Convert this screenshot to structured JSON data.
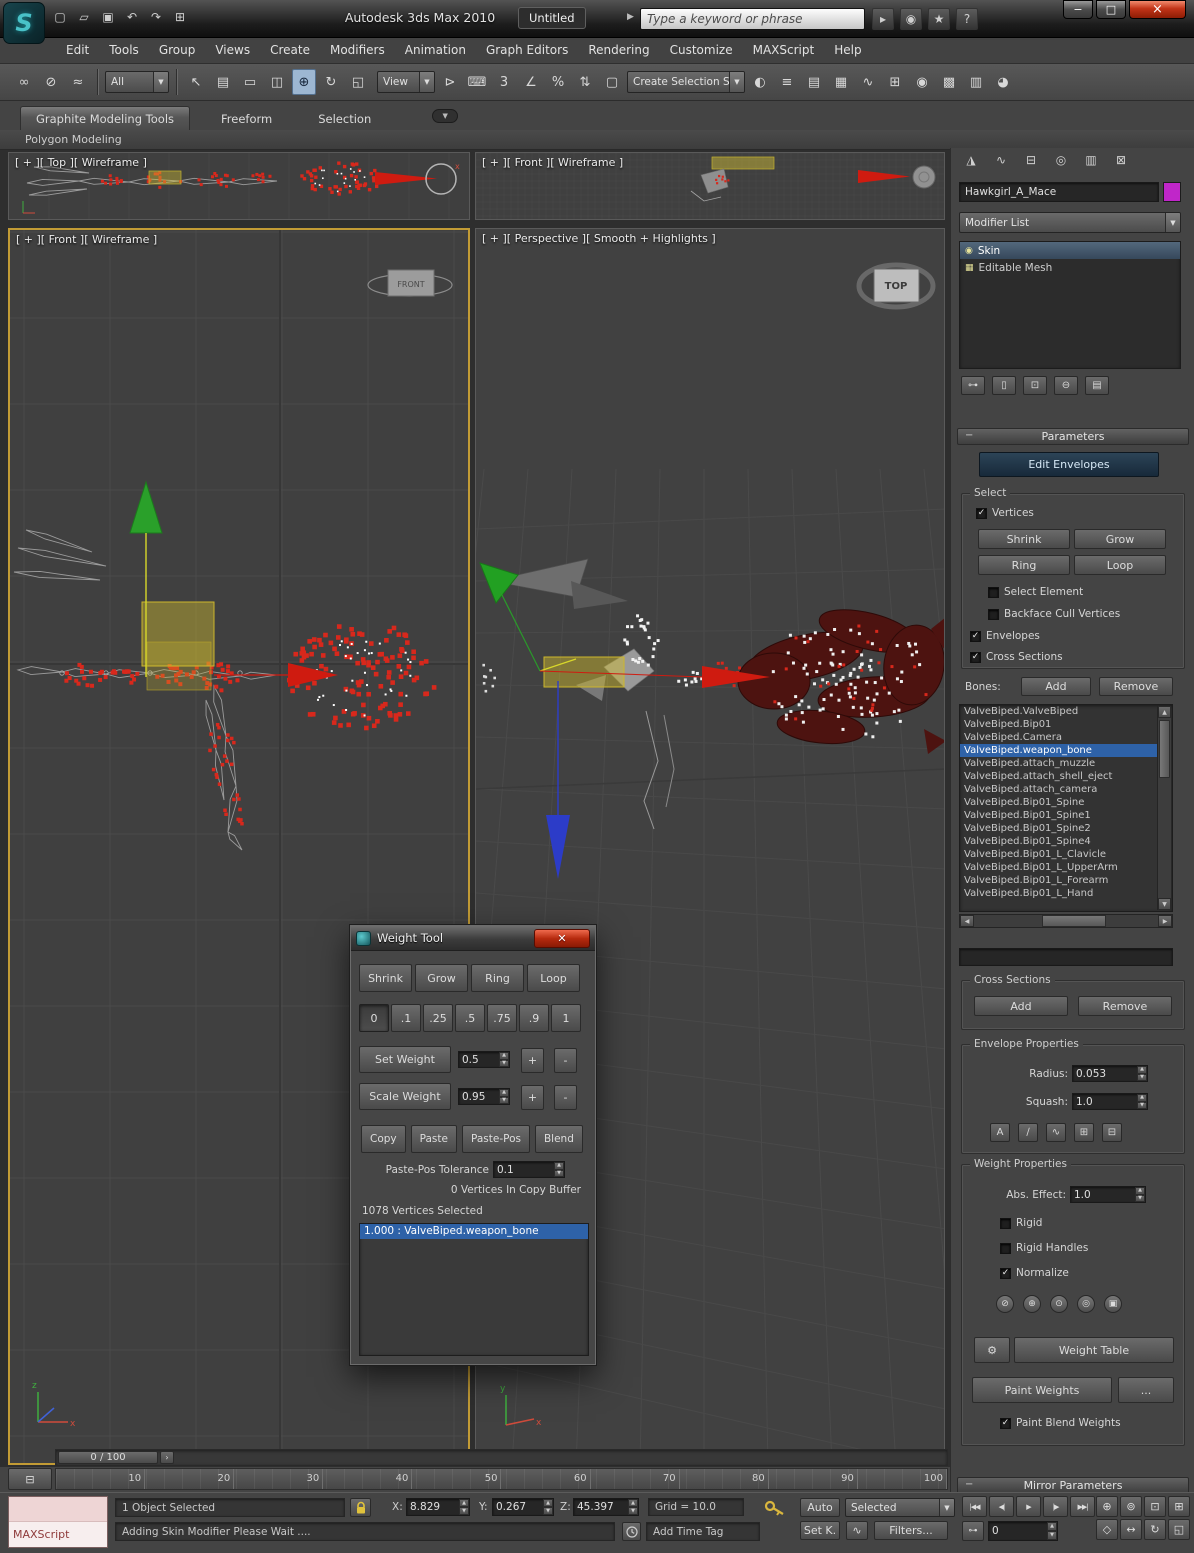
{
  "titlebar": {
    "app_title": "Autodesk 3ds Max  2010",
    "doc_title": "Untitled",
    "search_placeholder": "Type a keyword or phrase",
    "quick_icons": [
      {
        "n": "new-scene-icon",
        "g": "▢"
      },
      {
        "n": "open-file-icon",
        "g": "▱"
      },
      {
        "n": "save-file-icon",
        "g": "▣"
      },
      {
        "n": "undo-icon",
        "g": "↶"
      },
      {
        "n": "redo-icon",
        "g": "↷"
      },
      {
        "n": "clipboard-icon",
        "g": "⊞"
      }
    ],
    "infocenter_icons": [
      {
        "n": "search-go-icon",
        "g": "▸"
      },
      {
        "n": "communication-center-icon",
        "g": "◉"
      },
      {
        "n": "favorites-star-icon",
        "g": "★"
      },
      {
        "n": "help-icon",
        "g": "?"
      }
    ],
    "window_buttons": {
      "minimize": "−",
      "maximize": "□",
      "close": "×"
    }
  },
  "menu_items": [
    "Edit",
    "Tools",
    "Group",
    "Views",
    "Create",
    "Modifiers",
    "Animation",
    "Graph Editors",
    "Rendering",
    "Customize",
    "MAXScript",
    "Help"
  ],
  "toolbar": {
    "selection_filter": "All",
    "view_dropdown": "View",
    "named_selection": "Create Selection S",
    "icons_a": [
      {
        "n": "select-and-link-icon",
        "g": "∞"
      },
      {
        "n": "unlink-selection-icon",
        "g": "⊘"
      },
      {
        "n": "bind-to-spacewarp-icon",
        "g": "≈"
      }
    ],
    "icons_b": [
      {
        "n": "select-object-icon",
        "g": "↖"
      },
      {
        "n": "select-by-name-icon",
        "g": "▤"
      },
      {
        "n": "rectangular-selection-region-icon",
        "g": "▭"
      },
      {
        "n": "window-crossing-toggle-icon",
        "g": "◫"
      },
      {
        "n": "select-and-move-icon",
        "g": "⊕",
        "active": true
      },
      {
        "n": "select-and-rotate-icon",
        "g": "↻"
      },
      {
        "n": "select-and-scale-icon",
        "g": "◱"
      }
    ],
    "icons_c": [
      {
        "n": "select-and-manipulate-icon",
        "g": "⊳"
      },
      {
        "n": "keyboard-shortcut-override-icon",
        "g": "⌨"
      },
      {
        "n": "snaps-toggle-icon",
        "g": "3"
      },
      {
        "n": "angle-snap-icon",
        "g": "∠"
      },
      {
        "n": "percent-snap-icon",
        "g": "%"
      },
      {
        "n": "spinner-snap-icon",
        "g": "⇅"
      },
      {
        "n": "edit-named-selection-sets-icon",
        "g": "▢"
      }
    ],
    "icons_d": [
      {
        "n": "mirror-icon",
        "g": "◐"
      },
      {
        "n": "align-icon",
        "g": "≡"
      },
      {
        "n": "layer-manager-icon",
        "g": "▤"
      },
      {
        "n": "graphite-ribbon-toggle-icon",
        "g": "▦"
      },
      {
        "n": "curve-editor-icon",
        "g": "∿"
      },
      {
        "n": "schematic-view-icon",
        "g": "⊞"
      },
      {
        "n": "material-editor-icon",
        "g": "◉"
      },
      {
        "n": "render-setup-icon",
        "g": "▩"
      },
      {
        "n": "rendered-frame-window-icon",
        "g": "▥"
      },
      {
        "n": "render-production-icon",
        "g": "◕"
      }
    ]
  },
  "ribbon": {
    "tabs": [
      {
        "label": "Graphite Modeling Tools",
        "n": "tab-graphite-modeling-tools",
        "active": true
      },
      {
        "label": "Freeform",
        "n": "tab-freeform"
      },
      {
        "label": "Selection",
        "n": "tab-selection"
      }
    ],
    "panel": "Polygon Modeling"
  },
  "viewports": {
    "top_label": "[ + ][ Top ][ Wireframe ]",
    "front_small_label": "[ + ][ Front ][ Wireframe ]",
    "front_label": "[ + ][ Front ][ Wireframe ]",
    "persp_label": "[ + ][ Perspective ][ Smooth + Highlights ]",
    "viewcube": "TOP",
    "front_plate": "FRONT",
    "axis": {
      "x": "x",
      "y": "y",
      "z": "z"
    }
  },
  "command_panel": {
    "tab_icons": [
      {
        "n": "create-tab-icon",
        "g": "◮"
      },
      {
        "n": "modify-tab-icon",
        "g": "∿"
      },
      {
        "n": "hierarchy-tab-icon",
        "g": "⊟"
      },
      {
        "n": "motion-tab-icon",
        "g": "◎"
      },
      {
        "n": "display-tab-icon",
        "g": "▥"
      },
      {
        "n": "utilities-tab-icon",
        "g": "⊠"
      }
    ],
    "object_name": "Hawkgirl_A_Mace",
    "modifier_list_label": "Modifier List",
    "stack": [
      {
        "label": "Skin",
        "g": "◉",
        "n": "modifier-skin",
        "selected": true
      },
      {
        "label": "Editable Mesh",
        "g": "▦",
        "n": "modifier-editable-mesh"
      }
    ],
    "stack_ops": [
      {
        "n": "pin-stack-icon",
        "g": "⊶"
      },
      {
        "n": "show-end-result-icon",
        "g": "▯"
      },
      {
        "n": "make-unique-icon",
        "g": "⊡"
      },
      {
        "n": "remove-modifier-icon",
        "g": "⊖"
      },
      {
        "n": "configure-modifier-sets-icon",
        "g": "▤"
      }
    ],
    "parameters_title": "Parameters",
    "edit_envelopes": "Edit Envelopes",
    "select_group": "Select",
    "vertices_label": "Vertices",
    "shrink": "Shrink",
    "grow": "Grow",
    "ring": "Ring",
    "loop": "Loop",
    "select_element": "Select Element",
    "backface": "Backface Cull Vertices",
    "envelopes": "Envelopes",
    "cross_sections": "Cross Sections",
    "bones_label": "Bones:",
    "add": "Add",
    "remove": "Remove",
    "bones": [
      {
        "label": "ValveBiped.ValveBiped"
      },
      {
        "label": "ValveBiped.Bip01"
      },
      {
        "label": "ValveBiped.Camera"
      },
      {
        "label": "ValveBiped.weapon_bone",
        "selected": true
      },
      {
        "label": "ValveBiped.attach_muzzle"
      },
      {
        "label": "ValveBiped.attach_shell_eject"
      },
      {
        "label": "ValveBiped.attach_camera"
      },
      {
        "label": "ValveBiped.Bip01_Spine"
      },
      {
        "label": "ValveBiped.Bip01_Spine1"
      },
      {
        "label": "ValveBiped.Bip01_Spine2"
      },
      {
        "label": "ValveBiped.Bip01_Spine4"
      },
      {
        "label": "ValveBiped.Bip01_L_Clavicle"
      },
      {
        "label": "ValveBiped.Bip01_L_UpperArm"
      },
      {
        "label": "ValveBiped.Bip01_L_Forearm"
      },
      {
        "label": "ValveBiped.Bip01_L_Hand"
      }
    ],
    "cross_sections_group": "Cross Sections",
    "envelope_props_group": "Envelope Properties",
    "radius_label": "Radius:",
    "radius_value": "0.053",
    "squash_label": "Squash:",
    "squash_value": "1.0",
    "envelope_icons": [
      {
        "n": "absolute-effect-icon",
        "g": "A"
      },
      {
        "n": "falloff-icon",
        "g": "∕"
      },
      {
        "n": "curve-falloff-icon",
        "g": "∿"
      },
      {
        "n": "copy-envelope-icon",
        "g": "⊞"
      },
      {
        "n": "paste-envelope-icon",
        "g": "⊟"
      }
    ],
    "weight_props_group": "Weight Properties",
    "abs_effect_label": "Abs. Effect:",
    "abs_effect_value": "1.0",
    "rigid": "Rigid",
    "rigid_handles": "Rigid Handles",
    "normalize": "Normalize",
    "weight_icons": [
      {
        "n": "exclude-vertices-icon",
        "g": "⊘"
      },
      {
        "n": "include-vertices-icon",
        "g": "⊕"
      },
      {
        "n": "select-excluded-icon",
        "g": "⊙"
      },
      {
        "n": "bake-weights-icon",
        "g": "◎"
      },
      {
        "n": "weight-page-icon",
        "g": "▣"
      }
    ],
    "wrench_glyph": "⚙",
    "weight_table": "Weight Table",
    "paint_weights": "Paint Weights",
    "dots": "...",
    "paint_blend": "Paint Blend Weights",
    "mirror_parameters": "Mirror Parameters"
  },
  "weight_tool": {
    "title": "Weight Tool",
    "row1": [
      {
        "label": "Shrink",
        "n": "wt-shrink-button"
      },
      {
        "label": "Grow",
        "n": "wt-grow-button"
      },
      {
        "label": "Ring",
        "n": "wt-ring-button"
      },
      {
        "label": "Loop",
        "n": "wt-loop-button"
      }
    ],
    "presets": [
      {
        "label": "0",
        "n": "preset-0-button",
        "active": true
      },
      {
        "label": ".1",
        "n": "preset-p1-button"
      },
      {
        "label": ".25",
        "n": "preset-p25-button"
      },
      {
        "label": ".5",
        "n": "preset-p5-button"
      },
      {
        "label": ".75",
        "n": "preset-p75-button"
      },
      {
        "label": ".9",
        "n": "preset-p9-button"
      },
      {
        "label": "1",
        "n": "preset-1-button"
      }
    ],
    "set_weight": "Set Weight",
    "set_weight_value": "0.5",
    "scale_weight": "Scale Weight",
    "scale_weight_value": "0.95",
    "plus": "+",
    "minus": "-",
    "row3": [
      {
        "label": "Copy",
        "n": "wt-copy-button"
      },
      {
        "label": "Paste",
        "n": "wt-paste-button"
      },
      {
        "label": "Paste-Pos",
        "n": "wt-paste-pos-button"
      },
      {
        "label": "Blend",
        "n": "wt-blend-button"
      }
    ],
    "tolerance_label": "Paste-Pos Tolerance",
    "tolerance_value": "0.1",
    "copy_buffer_text": "0 Vertices In Copy Buffer",
    "selected_text": "1078 Vertices Selected",
    "weights": [
      {
        "label": "1.000 : ValveBiped.weapon_bone",
        "selected": true
      }
    ]
  },
  "timeline": {
    "slider_value": "0 / 100",
    "ticks": [
      "10",
      "20",
      "30",
      "40",
      "50",
      "60",
      "70",
      "80",
      "90",
      "100"
    ]
  },
  "status_bar": {
    "maxscript_label": "MAXScript",
    "selection_status": "1 Object Selected",
    "prompt": "Adding Skin Modifier Please Wait ....",
    "x_label": "X:",
    "x_value": "8.829",
    "y_label": "Y:",
    "y_value": "0.267",
    "z_label": "Z:",
    "z_value": "45.397",
    "grid_label": "Grid = 10.0",
    "add_time_tag": "Add Time Tag",
    "auto": "Auto",
    "key_filter": "Selected",
    "set_key": "Set K.",
    "filters": "Filters...",
    "time_value": "0",
    "transport": [
      {
        "n": "go-to-start-icon",
        "g": "|◀◀"
      },
      {
        "n": "previous-frame-icon",
        "g": "◀|"
      },
      {
        "n": "play-icon",
        "g": "▶"
      },
      {
        "n": "next-frame-icon",
        "g": "|▶"
      },
      {
        "n": "go-to-end-icon",
        "g": "▶▶|"
      }
    ],
    "nav_icons": [
      {
        "n": "zoom-icon",
        "g": "⊕"
      },
      {
        "n": "zoom-all-icon",
        "g": "⊚"
      },
      {
        "n": "zoom-extents-icon",
        "g": "⊡"
      },
      {
        "n": "zoom-extents-all-icon",
        "g": "⊞"
      },
      {
        "n": "field-of-view-icon",
        "g": "◇"
      },
      {
        "n": "pan-icon",
        "g": "↔"
      },
      {
        "n": "orbit-icon",
        "g": "↻"
      },
      {
        "n": "maximize-viewport-icon",
        "g": "◱"
      }
    ]
  }
}
